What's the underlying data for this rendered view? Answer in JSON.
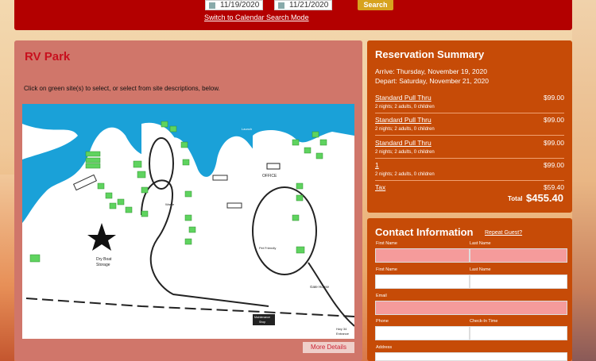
{
  "search": {
    "arrive_date": "11/19/2020",
    "depart_date": "11/21/2020",
    "search_label": "Search",
    "switch_label": "Switch to Calendar Search Mode"
  },
  "park": {
    "title": "RV Park",
    "hint": "Click on green site(s) to select, or select from site descriptions, below.",
    "more_details_label": "More Details",
    "map_labels": {
      "daily": "Daily",
      "office": "OFFICE",
      "dry_boat": "Dry Boat",
      "storage": "Storage",
      "gate_house": "Gate House",
      "maintenance": "Maintenance",
      "shop": "Shop",
      "pet_friendly": "Pet Friendly",
      "launch": "Launch",
      "waste": "Waste",
      "hwy": "Hwy 34",
      "entrance": "Entrance"
    }
  },
  "reservation": {
    "title": "Reservation Summary",
    "arrive": "Arrive: Thursday, November 19, 2020",
    "depart": "Depart: Saturday, November 21, 2020",
    "items": [
      {
        "name": "Standard Pull Thru",
        "price": "$99.00",
        "detail": "2 nights; 2 adults, 0 children"
      },
      {
        "name": "Standard Pull Thru",
        "price": "$99.00",
        "detail": "2 nights; 2 adults, 0 children"
      },
      {
        "name": "Standard Pull Thru",
        "price": "$99.00",
        "detail": "2 nights; 2 adults, 0 children"
      },
      {
        "name": "1",
        "price": "$99.00",
        "detail": "2 nights; 2 adults, 0 children"
      }
    ],
    "tax_label": "Tax",
    "tax_value": "$59.40",
    "total_label": "Total",
    "total_value": "$455.40"
  },
  "contact": {
    "title": "Contact Information",
    "repeat_label": "Repeat Guest?",
    "fields": {
      "first1": "First Name",
      "last1": "Last Name",
      "first2": "First Name",
      "last2": "Last Name",
      "email": "Email",
      "phone": "Phone",
      "checkin": "Check-In Time",
      "address": "Address"
    }
  },
  "colors": {
    "top_bar": "#b30000",
    "park_panel": "#d0766a",
    "summary_panel": "#c64b07",
    "required_field": "#f59b9b",
    "site_green": "#5fd35f",
    "water_blue": "#1aa1d8"
  }
}
